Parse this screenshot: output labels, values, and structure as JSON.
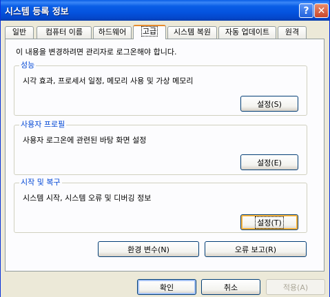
{
  "window": {
    "title": "시스템 등록 정보"
  },
  "tabs": [
    {
      "label": "일반"
    },
    {
      "label": "컴퓨터 이름"
    },
    {
      "label": "하드웨어"
    },
    {
      "label": "고급"
    },
    {
      "label": "시스템 복원"
    },
    {
      "label": "자동 업데이트"
    },
    {
      "label": "원격"
    }
  ],
  "active_tab": "고급",
  "intro": "이 내용을 변경하려면 관리자로 로그온해야 합니다.",
  "groups": {
    "performance": {
      "title": "성능",
      "desc": "시각 효과, 프로세서 일정, 메모리 사용 및 가상 메모리",
      "button": "설정(S)"
    },
    "profile": {
      "title": "사용자 프로필",
      "desc": "사용자 로그온에 관련된 바탕 화면 설정",
      "button": "설정(E)"
    },
    "startup": {
      "title": "시작 및 복구",
      "desc": "시스템 시작, 시스템 오류 및 디버깅 정보",
      "button": "설정(T)"
    }
  },
  "buttons": {
    "env": "환경 변수(N)",
    "error_report": "오류 보고(R)",
    "ok": "확인",
    "cancel": "취소",
    "apply": "적용(A)"
  },
  "icons": {
    "help": "question-mark",
    "close": "x-mark"
  }
}
